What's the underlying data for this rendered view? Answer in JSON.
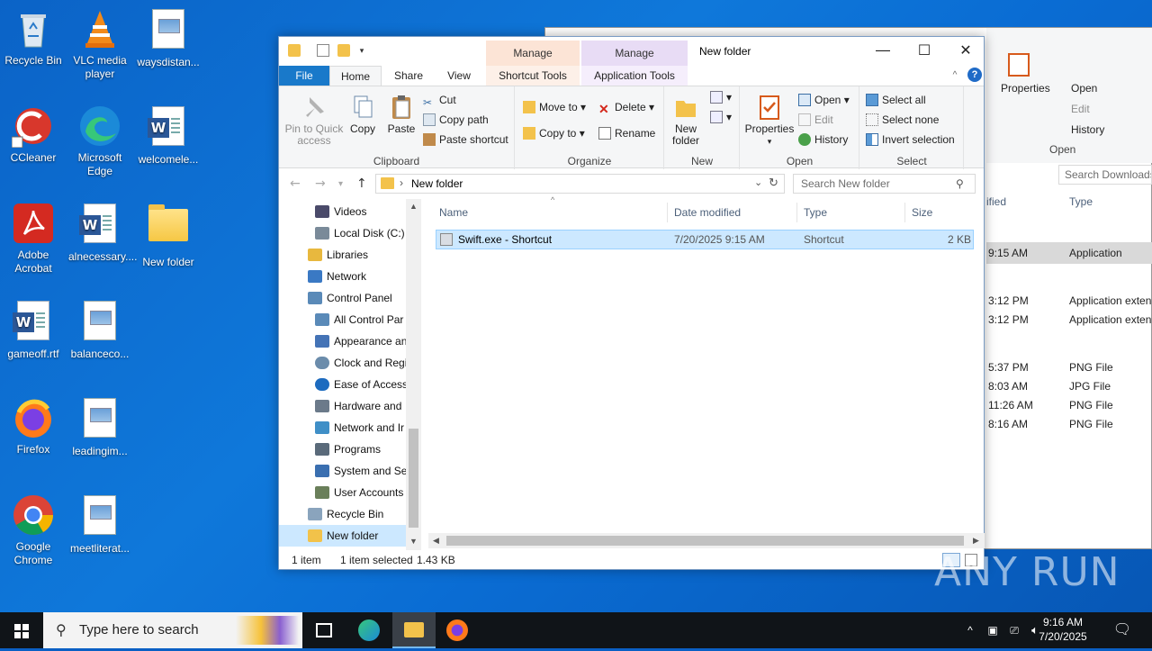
{
  "desktop": {
    "icons": [
      {
        "label": "Recycle Bin"
      },
      {
        "label": "VLC media player"
      },
      {
        "label": "waysdistan..."
      },
      {
        "label": "CCleaner"
      },
      {
        "label": "Microsoft Edge"
      },
      {
        "label": "welcomele..."
      },
      {
        "label": "Adobe Acrobat"
      },
      {
        "label": "alnecessary...."
      },
      {
        "label": "New folder"
      },
      {
        "label": "gameoff.rtf"
      },
      {
        "label": "balanceco..."
      },
      {
        "label": "Firefox"
      },
      {
        "label": "leadingim..."
      },
      {
        "label": "Google Chrome"
      },
      {
        "label": "meetliterat..."
      }
    ]
  },
  "backwin": {
    "ribbon": {
      "open": "Open",
      "edit": "Edit",
      "history": "History",
      "properties": "Properties",
      "group_open": "Open"
    },
    "search_placeholder": "Search Downloads",
    "col_modified": "ified",
    "col_type": "Type",
    "rows": [
      {
        "time": "9:15 AM",
        "type": "Application"
      },
      {
        "time": "3:12 PM",
        "type": "Application exten"
      },
      {
        "time": "3:12 PM",
        "type": "Application exten"
      },
      {
        "time": "5:37 PM",
        "type": "PNG File"
      },
      {
        "time": "8:03 AM",
        "type": "JPG File"
      },
      {
        "time": "11:26 AM",
        "type": "PNG File"
      },
      {
        "time": "8:16 AM",
        "type": "PNG File"
      }
    ]
  },
  "window": {
    "title": "New folder",
    "ctx_manage1": "Manage",
    "ctx_manage2": "Manage",
    "tabs": {
      "file": "File",
      "home": "Home",
      "share": "Share",
      "view": "View",
      "shortcut_tools": "Shortcut Tools",
      "application_tools": "Application Tools"
    },
    "ribbon": {
      "pin": "Pin to Quick access",
      "copy": "Copy",
      "paste": "Paste",
      "cut": "Cut",
      "copy_path": "Copy path",
      "paste_shortcut": "Paste shortcut",
      "group_clipboard": "Clipboard",
      "move_to": "Move to",
      "copy_to": "Copy to",
      "delete": "Delete",
      "rename": "Rename",
      "group_organize": "Organize",
      "new_folder": "New folder",
      "group_new": "New",
      "properties": "Properties",
      "open": "Open",
      "edit": "Edit",
      "history": "History",
      "group_open": "Open",
      "select_all": "Select all",
      "select_none": "Select none",
      "invert_selection": "Invert selection",
      "group_select": "Select"
    },
    "address": {
      "path": "New folder",
      "search_placeholder": "Search New folder"
    },
    "nav": [
      {
        "label": "Videos",
        "color": "#4a4a6a"
      },
      {
        "label": "Local Disk (C:)",
        "color": "#7a8a99"
      },
      {
        "label": "Libraries",
        "color": "#e8b83e"
      },
      {
        "label": "Network",
        "color": "#3a79c4"
      },
      {
        "label": "Control Panel",
        "color": "#5a8ab8"
      },
      {
        "label": "All Control Par",
        "color": "#5a8ab8"
      },
      {
        "label": "Appearance an",
        "color": "#4473b6"
      },
      {
        "label": "Clock and Regi",
        "color": "#6b8cab"
      },
      {
        "label": "Ease of Access",
        "color": "#1d6bbf"
      },
      {
        "label": "Hardware and",
        "color": "#6b7a8a"
      },
      {
        "label": "Network and Ir",
        "color": "#3f8fc7"
      },
      {
        "label": "Programs",
        "color": "#5a6a7a"
      },
      {
        "label": "System and Sec",
        "color": "#3a6fb0"
      },
      {
        "label": "User Accounts",
        "color": "#6a7f5a"
      },
      {
        "label": "Recycle Bin",
        "color": "#8aa4bd"
      },
      {
        "label": "New folder",
        "color": "#f2c24a"
      }
    ],
    "columns": {
      "name": "Name",
      "date": "Date modified",
      "type": "Type",
      "size": "Size"
    },
    "files": [
      {
        "name": "Swift.exe - Shortcut",
        "date": "7/20/2025 9:15 AM",
        "type": "Shortcut",
        "size": "2 KB"
      }
    ],
    "status": {
      "count": "1 item",
      "selected": "1 item selected",
      "size": "1.43 KB"
    }
  },
  "taskbar": {
    "search_placeholder": "Type here to search",
    "time": "9:16 AM",
    "date": "7/20/2025"
  },
  "watermark": "ANY RUN"
}
